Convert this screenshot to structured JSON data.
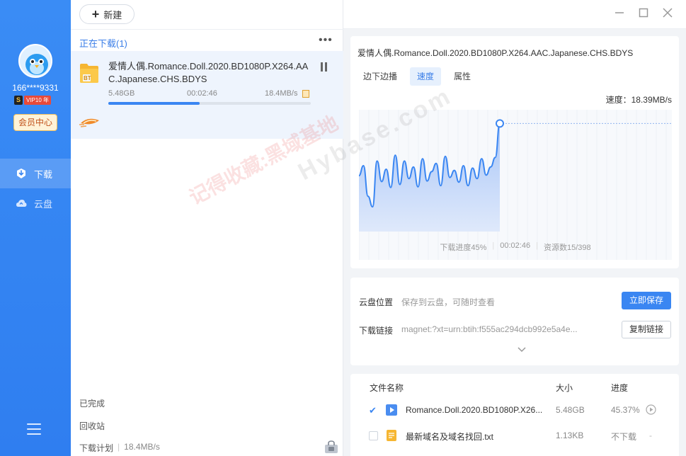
{
  "sidebar": {
    "username": "166****9331",
    "vip_s": "S",
    "vip_label": "VIP10 年",
    "member_center": "会员中心",
    "nav": [
      {
        "label": "下载",
        "icon": "download-icon",
        "active": true
      },
      {
        "label": "云盘",
        "icon": "cloud-icon",
        "active": false
      }
    ],
    "menu_icon": "hamburger-icon"
  },
  "toolbar": {
    "new_label": "新建"
  },
  "downloads": {
    "section_title": "正在下载(1)",
    "more": "•••",
    "task": {
      "type_badge": "BT",
      "name": "爱情人偶.Romance.Doll.2020.BD1080P.X264.AAC.Japanese.CHS.BDYS",
      "size": "5.48GB",
      "elapsed": "00:02:46",
      "speed": "18.4MB/s",
      "progress_fraction": 0.45
    },
    "completed": "已完成",
    "recycle": "回收站",
    "plan_label": "下载计划",
    "plan_value": "18.4MB/s"
  },
  "detail": {
    "file_title": "爱情人偶.Romance.Doll.2020.BD1080P.X264.AAC.Japanese.CHS.BDYS",
    "tabs": [
      "边下边播",
      "速度",
      "属性"
    ],
    "active_tab": 1,
    "speed_readout": "速度：18.39MB/s",
    "stats": {
      "progress": "下载进度45%",
      "time": "00:02:46",
      "resources": "资源数15/398"
    }
  },
  "chart_data": {
    "type": "area",
    "title": "",
    "xlabel": "",
    "ylabel": "",
    "series": [
      {
        "values": [
          9.5,
          11.2,
          6.0,
          4.2,
          12.0,
          8.5,
          10.6,
          7.5,
          13.0,
          8.0,
          12.0,
          9.0,
          11.0,
          7.6,
          12.4,
          8.6,
          10.2,
          11.6,
          7.8,
          12.8,
          9.2,
          10.4,
          8.4,
          11.2,
          7.8,
          10.8,
          9.0,
          12.4,
          9.6,
          11.0,
          12.6,
          18.39
        ]
      }
    ],
    "current_value": 18.39,
    "unit": "MB/s"
  },
  "cloud": {
    "location_label": "云盘位置",
    "location_text": "保存到云盘，可随时查看",
    "save_button": "立即保存",
    "link_label": "下载链接",
    "link_text": "magnet:?xt=urn:btih:f555ac294dcb992e5a4e...",
    "copy_button": "复制链接"
  },
  "files": {
    "headers": {
      "name": "文件名称",
      "size": "大小",
      "progress": "进度"
    },
    "rows": [
      {
        "checked": true,
        "icon": "video-file-icon",
        "name": "Romance.Doll.2020.BD1080P.X26...",
        "size": "5.48GB",
        "progress": "45.37%"
      },
      {
        "checked": false,
        "icon": "text-file-icon",
        "name": "最新域名及域名找回.txt",
        "size": "1.13KB",
        "progress": "不下载",
        "extra": "-"
      }
    ]
  },
  "watermark": {
    "line1": "记得收藏:黑域基地",
    "line2": "Hybase.com"
  },
  "colors": {
    "accent": "#3a86f2",
    "sidebar": "#3585f2",
    "chart_fill": "#c9dcfa",
    "chart_line": "#3a86f2"
  }
}
